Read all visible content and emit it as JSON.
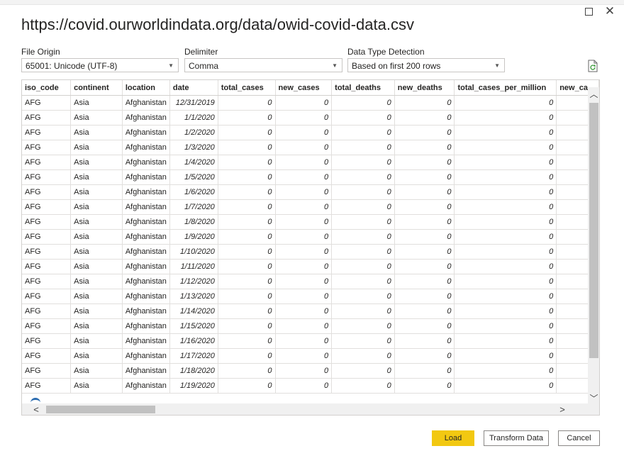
{
  "dialog": {
    "title": "https://covid.ourworldindata.org/data/owid-covid-data.csv"
  },
  "options": {
    "file_origin": {
      "label": "File Origin",
      "value": "65001: Unicode (UTF-8)"
    },
    "delimiter": {
      "label": "Delimiter",
      "value": "Comma"
    },
    "detection": {
      "label": "Data Type Detection",
      "value": "Based on first 200 rows"
    }
  },
  "table": {
    "columns": [
      "iso_code",
      "continent",
      "location",
      "date",
      "total_cases",
      "new_cases",
      "total_deaths",
      "new_deaths",
      "total_cases_per_million",
      "new_ca"
    ],
    "rows": [
      [
        "AFG",
        "Asia",
        "Afghanistan",
        "12/31/2019",
        "0",
        "0",
        "0",
        "0",
        "0"
      ],
      [
        "AFG",
        "Asia",
        "Afghanistan",
        "1/1/2020",
        "0",
        "0",
        "0",
        "0",
        "0"
      ],
      [
        "AFG",
        "Asia",
        "Afghanistan",
        "1/2/2020",
        "0",
        "0",
        "0",
        "0",
        "0"
      ],
      [
        "AFG",
        "Asia",
        "Afghanistan",
        "1/3/2020",
        "0",
        "0",
        "0",
        "0",
        "0"
      ],
      [
        "AFG",
        "Asia",
        "Afghanistan",
        "1/4/2020",
        "0",
        "0",
        "0",
        "0",
        "0"
      ],
      [
        "AFG",
        "Asia",
        "Afghanistan",
        "1/5/2020",
        "0",
        "0",
        "0",
        "0",
        "0"
      ],
      [
        "AFG",
        "Asia",
        "Afghanistan",
        "1/6/2020",
        "0",
        "0",
        "0",
        "0",
        "0"
      ],
      [
        "AFG",
        "Asia",
        "Afghanistan",
        "1/7/2020",
        "0",
        "0",
        "0",
        "0",
        "0"
      ],
      [
        "AFG",
        "Asia",
        "Afghanistan",
        "1/8/2020",
        "0",
        "0",
        "0",
        "0",
        "0"
      ],
      [
        "AFG",
        "Asia",
        "Afghanistan",
        "1/9/2020",
        "0",
        "0",
        "0",
        "0",
        "0"
      ],
      [
        "AFG",
        "Asia",
        "Afghanistan",
        "1/10/2020",
        "0",
        "0",
        "0",
        "0",
        "0"
      ],
      [
        "AFG",
        "Asia",
        "Afghanistan",
        "1/11/2020",
        "0",
        "0",
        "0",
        "0",
        "0"
      ],
      [
        "AFG",
        "Asia",
        "Afghanistan",
        "1/12/2020",
        "0",
        "0",
        "0",
        "0",
        "0"
      ],
      [
        "AFG",
        "Asia",
        "Afghanistan",
        "1/13/2020",
        "0",
        "0",
        "0",
        "0",
        "0"
      ],
      [
        "AFG",
        "Asia",
        "Afghanistan",
        "1/14/2020",
        "0",
        "0",
        "0",
        "0",
        "0"
      ],
      [
        "AFG",
        "Asia",
        "Afghanistan",
        "1/15/2020",
        "0",
        "0",
        "0",
        "0",
        "0"
      ],
      [
        "AFG",
        "Asia",
        "Afghanistan",
        "1/16/2020",
        "0",
        "0",
        "0",
        "0",
        "0"
      ],
      [
        "AFG",
        "Asia",
        "Afghanistan",
        "1/17/2020",
        "0",
        "0",
        "0",
        "0",
        "0"
      ],
      [
        "AFG",
        "Asia",
        "Afghanistan",
        "1/18/2020",
        "0",
        "0",
        "0",
        "0",
        "0"
      ],
      [
        "AFG",
        "Asia",
        "Afghanistan",
        "1/19/2020",
        "0",
        "0",
        "0",
        "0",
        "0"
      ]
    ]
  },
  "buttons": {
    "load": "Load",
    "transform": "Transform Data",
    "cancel": "Cancel"
  },
  "colors": {
    "load_accent": "#f2c811"
  },
  "icons": {
    "maximize": "maximize-icon",
    "close": "close-icon",
    "refresh": "refresh-file-icon"
  }
}
